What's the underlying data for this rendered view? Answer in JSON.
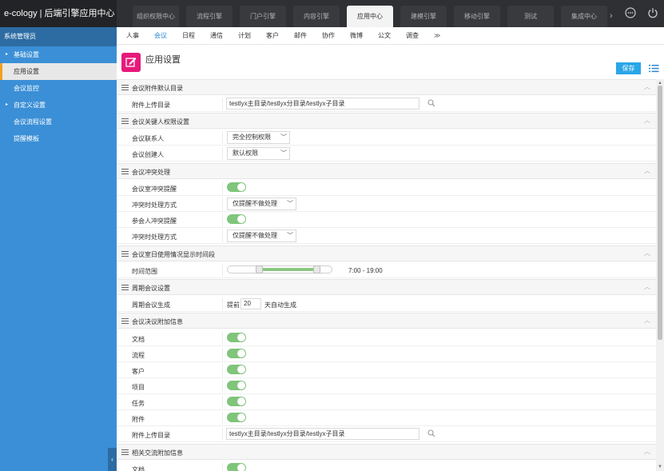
{
  "app": {
    "brand": "e-cology | 后端引擎应用中心"
  },
  "topnav": {
    "tabs": [
      "组织权限中心",
      "流程引擎",
      "门户引擎",
      "内容引擎",
      "应用中心",
      "建模引擎",
      "移动引擎",
      "测试",
      "集成中心"
    ],
    "more": "›",
    "active": "应用中心"
  },
  "sidebar": {
    "user": "系统管理员",
    "items": [
      {
        "label": "基础设置",
        "arrow": "▸"
      },
      {
        "label": "应用设置"
      },
      {
        "label": "会议监控"
      },
      {
        "label": "自定义设置",
        "arrow": "▸"
      },
      {
        "label": "会议流程设置"
      },
      {
        "label": "提醒模板"
      }
    ],
    "collapse": "‹"
  },
  "subnav": {
    "tabs": [
      "人事",
      "会议",
      "日程",
      "通信",
      "计划",
      "客户",
      "邮件",
      "协作",
      "微博",
      "公文",
      "调查"
    ],
    "more": "≫",
    "active": "会议"
  },
  "page": {
    "title": "应用设置",
    "save": "保存"
  },
  "sections": {
    "attach": {
      "title": "会议附件默认目录",
      "row_label": "附件上传目录",
      "path": "testlyx主目录/testlyx分目录/testlyx子目录"
    },
    "perm": {
      "title": "会议关键人权限设置",
      "contact_label": "会议联系人",
      "contact_value": "完全控制权限",
      "creator_label": "会议创建人",
      "creator_value": "默认权限"
    },
    "conflict": {
      "title": "会议冲突处理",
      "room_label": "会议室冲突提醒",
      "room_method_label": "冲突时处理方式",
      "room_method_value": "仅提醒不做处理",
      "member_label": "参会人冲突提醒",
      "member_method_label": "冲突时处理方式",
      "member_method_value": "仅提醒不做处理"
    },
    "usage": {
      "title": "会议室日使用情况显示时间段",
      "row_label": "时间范围",
      "range": "7:00 - 19:00",
      "start_fraction": 0.3,
      "end_fraction": 0.86
    },
    "periodic": {
      "title": "周期会议设置",
      "row_label": "周期会议生成",
      "prefix": "提前",
      "days": "20",
      "suffix": "天自动生成"
    },
    "decision": {
      "title": "会议决议附加信息",
      "rows": [
        "文档",
        "流程",
        "客户",
        "项目",
        "任务",
        "附件"
      ],
      "upload_label": "附件上传目录",
      "path": "testlyx主目录/testlyx分目录/testlyx子目录"
    },
    "exchange": {
      "title": "相关交流附加信息",
      "rows": [
        "文档"
      ]
    }
  },
  "colors": {
    "accent": "#29a6e8",
    "sidebar": "#3b8fd6",
    "toggle_on": "#7fc57a",
    "app_icon": "#e6197a"
  }
}
